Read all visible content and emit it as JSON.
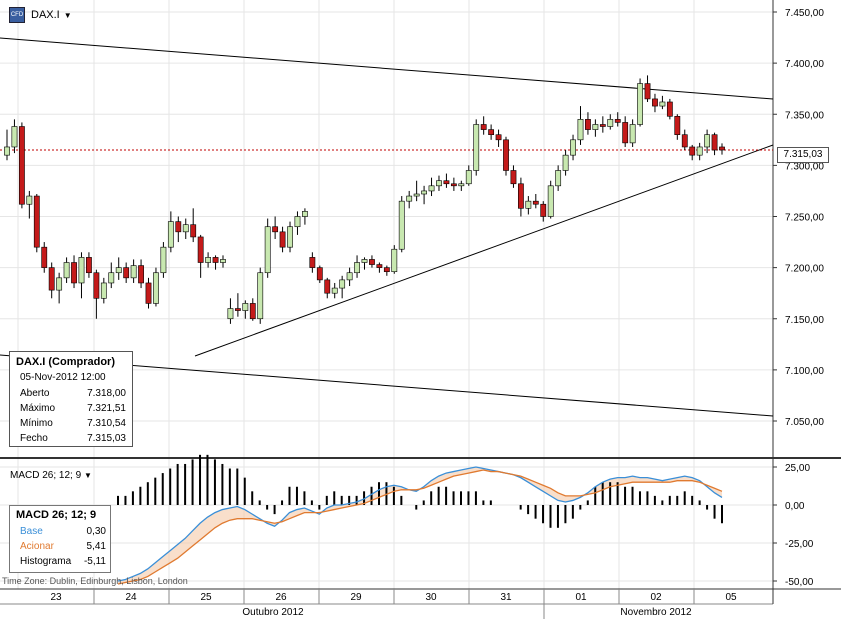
{
  "header": {
    "symbol": "DAX.I",
    "icon_text": "CFD"
  },
  "price_axis": [
    "7.450,00",
    "7.400,00",
    "7.350,00",
    "7.300,00",
    "7.250,00",
    "7.200,00",
    "7.150,00",
    "7.100,00",
    "7.050,00"
  ],
  "current_price_label": "7.315,03",
  "info_box": {
    "title": "DAX.I (Comprador)",
    "datetime": "05-Nov-2012 12:00",
    "rows": [
      {
        "label": "Aberto",
        "value": "7.318,00"
      },
      {
        "label": "Máximo",
        "value": "7.321,51"
      },
      {
        "label": "Mínimo",
        "value": "7.310,54"
      },
      {
        "label": "Fecho",
        "value": "7.315,03"
      }
    ]
  },
  "macd_header": "MACD 26; 12; 9",
  "macd_axis": [
    "25,00",
    "0,00",
    "-25,00",
    "-50,00"
  ],
  "macd_box": {
    "title": "MACD 26; 12; 9",
    "rows": [
      {
        "label": "Base",
        "value": "0,30",
        "color": "#3a8fd8"
      },
      {
        "label": "Acionar",
        "value": "5,41",
        "color": "#e07a30"
      },
      {
        "label": "Histograma",
        "value": "-5,11",
        "color": "#000000"
      }
    ]
  },
  "timezone": "Time Zone: Dublin, Edinburgh, Lisbon, London",
  "x_axis": {
    "days": [
      "23",
      "24",
      "25",
      "26",
      "29",
      "30",
      "31",
      "01",
      "02",
      "05"
    ],
    "months": [
      "Outubro 2012",
      "Novembro 2012"
    ]
  },
  "chart_data": {
    "type": "candlestick",
    "ylim": [
      7030,
      7460
    ],
    "current_price": 7315.03,
    "candles": [
      {
        "o": 7310,
        "h": 7335,
        "l": 7305,
        "c": 7318
      },
      {
        "o": 7318,
        "h": 7345,
        "l": 7312,
        "c": 7338
      },
      {
        "o": 7338,
        "h": 7342,
        "l": 7258,
        "c": 7262
      },
      {
        "o": 7262,
        "h": 7275,
        "l": 7248,
        "c": 7270
      },
      {
        "o": 7270,
        "h": 7272,
        "l": 7215,
        "c": 7220
      },
      {
        "o": 7220,
        "h": 7225,
        "l": 7195,
        "c": 7200
      },
      {
        "o": 7200,
        "h": 7205,
        "l": 7170,
        "c": 7178
      },
      {
        "o": 7178,
        "h": 7195,
        "l": 7165,
        "c": 7190
      },
      {
        "o": 7190,
        "h": 7210,
        "l": 7185,
        "c": 7205
      },
      {
        "o": 7205,
        "h": 7212,
        "l": 7180,
        "c": 7185
      },
      {
        "o": 7185,
        "h": 7215,
        "l": 7170,
        "c": 7210
      },
      {
        "o": 7210,
        "h": 7215,
        "l": 7190,
        "c": 7195
      },
      {
        "o": 7195,
        "h": 7198,
        "l": 7150,
        "c": 7170
      },
      {
        "o": 7170,
        "h": 7190,
        "l": 7165,
        "c": 7185
      },
      {
        "o": 7185,
        "h": 7205,
        "l": 7180,
        "c": 7195
      },
      {
        "o": 7195,
        "h": 7210,
        "l": 7188,
        "c": 7200
      },
      {
        "o": 7200,
        "h": 7205,
        "l": 7185,
        "c": 7190
      },
      {
        "o": 7190,
        "h": 7208,
        "l": 7185,
        "c": 7202
      },
      {
        "o": 7202,
        "h": 7208,
        "l": 7180,
        "c": 7185
      },
      {
        "o": 7185,
        "h": 7190,
        "l": 7160,
        "c": 7165
      },
      {
        "o": 7165,
        "h": 7200,
        "l": 7162,
        "c": 7195
      },
      {
        "o": 7195,
        "h": 7225,
        "l": 7190,
        "c": 7220
      },
      {
        "o": 7220,
        "h": 7255,
        "l": 7215,
        "c": 7245
      },
      {
        "o": 7245,
        "h": 7250,
        "l": 7225,
        "c": 7235
      },
      {
        "o": 7235,
        "h": 7248,
        "l": 7228,
        "c": 7242
      },
      {
        "o": 7242,
        "h": 7258,
        "l": 7225,
        "c": 7230
      },
      {
        "o": 7230,
        "h": 7232,
        "l": 7190,
        "c": 7205
      },
      {
        "o": 7205,
        "h": 7215,
        "l": 7200,
        "c": 7210
      },
      {
        "o": 7210,
        "h": 7212,
        "l": 7198,
        "c": 7205
      },
      {
        "o": 7205,
        "h": 7212,
        "l": 7200,
        "c": 7208
      },
      {
        "o": 7150,
        "h": 7170,
        "l": 7145,
        "c": 7160
      },
      {
        "o": 7160,
        "h": 7175,
        "l": 7152,
        "c": 7158
      },
      {
        "o": 7158,
        "h": 7168,
        "l": 7150,
        "c": 7165
      },
      {
        "o": 7165,
        "h": 7170,
        "l": 7148,
        "c": 7150
      },
      {
        "o": 7150,
        "h": 7200,
        "l": 7145,
        "c": 7195
      },
      {
        "o": 7195,
        "h": 7248,
        "l": 7190,
        "c": 7240
      },
      {
        "o": 7240,
        "h": 7250,
        "l": 7228,
        "c": 7235
      },
      {
        "o": 7235,
        "h": 7240,
        "l": 7215,
        "c": 7220
      },
      {
        "o": 7220,
        "h": 7245,
        "l": 7215,
        "c": 7240
      },
      {
        "o": 7240,
        "h": 7255,
        "l": 7232,
        "c": 7250
      },
      {
        "o": 7250,
        "h": 7258,
        "l": 7242,
        "c": 7255
      },
      {
        "o": 7210,
        "h": 7215,
        "l": 7195,
        "c": 7200
      },
      {
        "o": 7200,
        "h": 7202,
        "l": 7185,
        "c": 7188
      },
      {
        "o": 7188,
        "h": 7190,
        "l": 7170,
        "c": 7175
      },
      {
        "o": 7175,
        "h": 7185,
        "l": 7170,
        "c": 7180
      },
      {
        "o": 7180,
        "h": 7192,
        "l": 7170,
        "c": 7188
      },
      {
        "o": 7188,
        "h": 7200,
        "l": 7182,
        "c": 7195
      },
      {
        "o": 7195,
        "h": 7212,
        "l": 7190,
        "c": 7205
      },
      {
        "o": 7205,
        "h": 7210,
        "l": 7198,
        "c": 7208
      },
      {
        "o": 7208,
        "h": 7212,
        "l": 7200,
        "c": 7203
      },
      {
        "o": 7203,
        "h": 7205,
        "l": 7195,
        "c": 7200
      },
      {
        "o": 7200,
        "h": 7202,
        "l": 7192,
        "c": 7196
      },
      {
        "o": 7196,
        "h": 7222,
        "l": 7194,
        "c": 7218
      },
      {
        "o": 7218,
        "h": 7270,
        "l": 7215,
        "c": 7265
      },
      {
        "o": 7265,
        "h": 7275,
        "l": 7258,
        "c": 7270
      },
      {
        "o": 7270,
        "h": 7285,
        "l": 7265,
        "c": 7272
      },
      {
        "o": 7272,
        "h": 7280,
        "l": 7262,
        "c": 7275
      },
      {
        "o": 7275,
        "h": 7288,
        "l": 7270,
        "c": 7280
      },
      {
        "o": 7280,
        "h": 7290,
        "l": 7275,
        "c": 7285
      },
      {
        "o": 7285,
        "h": 7292,
        "l": 7278,
        "c": 7282
      },
      {
        "o": 7282,
        "h": 7288,
        "l": 7275,
        "c": 7280
      },
      {
        "o": 7280,
        "h": 7285,
        "l": 7275,
        "c": 7282
      },
      {
        "o": 7282,
        "h": 7300,
        "l": 7280,
        "c": 7295
      },
      {
        "o": 7295,
        "h": 7345,
        "l": 7290,
        "c": 7340
      },
      {
        "o": 7340,
        "h": 7348,
        "l": 7330,
        "c": 7335
      },
      {
        "o": 7335,
        "h": 7340,
        "l": 7325,
        "c": 7330
      },
      {
        "o": 7330,
        "h": 7335,
        "l": 7318,
        "c": 7325
      },
      {
        "o": 7325,
        "h": 7328,
        "l": 7290,
        "c": 7295
      },
      {
        "o": 7295,
        "h": 7300,
        "l": 7278,
        "c": 7282
      },
      {
        "o": 7282,
        "h": 7288,
        "l": 7250,
        "c": 7258
      },
      {
        "o": 7258,
        "h": 7270,
        "l": 7252,
        "c": 7265
      },
      {
        "o": 7265,
        "h": 7272,
        "l": 7258,
        "c": 7262
      },
      {
        "o": 7262,
        "h": 7265,
        "l": 7245,
        "c": 7250
      },
      {
        "o": 7250,
        "h": 7285,
        "l": 7248,
        "c": 7280
      },
      {
        "o": 7280,
        "h": 7300,
        "l": 7275,
        "c": 7295
      },
      {
        "o": 7295,
        "h": 7315,
        "l": 7290,
        "c": 7310
      },
      {
        "o": 7310,
        "h": 7330,
        "l": 7305,
        "c": 7325
      },
      {
        "o": 7325,
        "h": 7358,
        "l": 7320,
        "c": 7345
      },
      {
        "o": 7345,
        "h": 7352,
        "l": 7330,
        "c": 7335
      },
      {
        "o": 7335,
        "h": 7345,
        "l": 7328,
        "c": 7340
      },
      {
        "o": 7340,
        "h": 7348,
        "l": 7332,
        "c": 7338
      },
      {
        "o": 7338,
        "h": 7350,
        "l": 7335,
        "c": 7345
      },
      {
        "o": 7345,
        "h": 7352,
        "l": 7338,
        "c": 7342
      },
      {
        "o": 7342,
        "h": 7348,
        "l": 7318,
        "c": 7322
      },
      {
        "o": 7322,
        "h": 7345,
        "l": 7318,
        "c": 7340
      },
      {
        "o": 7340,
        "h": 7385,
        "l": 7338,
        "c": 7380
      },
      {
        "o": 7380,
        "h": 7388,
        "l": 7362,
        "c": 7365
      },
      {
        "o": 7365,
        "h": 7370,
        "l": 7352,
        "c": 7358
      },
      {
        "o": 7358,
        "h": 7368,
        "l": 7355,
        "c": 7362
      },
      {
        "o": 7362,
        "h": 7365,
        "l": 7345,
        "c": 7348
      },
      {
        "o": 7348,
        "h": 7350,
        "l": 7325,
        "c": 7330
      },
      {
        "o": 7330,
        "h": 7335,
        "l": 7315,
        "c": 7318
      },
      {
        "o": 7318,
        "h": 7320,
        "l": 7305,
        "c": 7310
      },
      {
        "o": 7310,
        "h": 7322,
        "l": 7305,
        "c": 7318
      },
      {
        "o": 7318,
        "h": 7335,
        "l": 7312,
        "c": 7330
      },
      {
        "o": 7330,
        "h": 7332,
        "l": 7310,
        "c": 7315
      },
      {
        "o": 7318,
        "h": 7321.51,
        "l": 7310.54,
        "c": 7315.03
      }
    ],
    "macd": {
      "ylim": [
        -57,
        30
      ],
      "base": [
        -50,
        -49,
        -47,
        -45,
        -42,
        -38,
        -34,
        -30,
        -26,
        -22,
        -17,
        -12,
        -8,
        -5,
        -3,
        -2,
        -1,
        -3,
        -6,
        -9,
        -12,
        -14,
        -10,
        -5,
        -3,
        -2,
        -4,
        -6,
        -2,
        0,
        0,
        1,
        2,
        4,
        7,
        10,
        12,
        13,
        12,
        10,
        9,
        12,
        16,
        19,
        21,
        22,
        23,
        24,
        25,
        24,
        23,
        22,
        21,
        20,
        18,
        15,
        12,
        9,
        6,
        3,
        2,
        3,
        5,
        8,
        12,
        15,
        17,
        18,
        18,
        19,
        18,
        18,
        17,
        16,
        17,
        18,
        19,
        18,
        16,
        12,
        8,
        5
      ],
      "trigger": [
        -52,
        -51,
        -50,
        -49,
        -47,
        -44,
        -41,
        -38,
        -35,
        -31,
        -27,
        -23,
        -19,
        -15,
        -12,
        -10,
        -9,
        -9,
        -9,
        -10,
        -11,
        -12,
        -11,
        -9,
        -7,
        -5,
        -5,
        -5,
        -4,
        -3,
        -2,
        -1,
        0,
        1,
        3,
        5,
        7,
        9,
        10,
        10,
        10,
        11,
        13,
        15,
        17,
        19,
        20,
        21,
        22,
        23,
        22,
        22,
        21,
        20,
        19,
        17,
        15,
        13,
        11,
        8,
        6,
        6,
        6,
        7,
        8,
        10,
        12,
        13,
        14,
        15,
        15,
        15,
        15,
        15,
        15,
        16,
        16,
        16,
        15,
        13,
        11,
        9
      ]
    }
  }
}
